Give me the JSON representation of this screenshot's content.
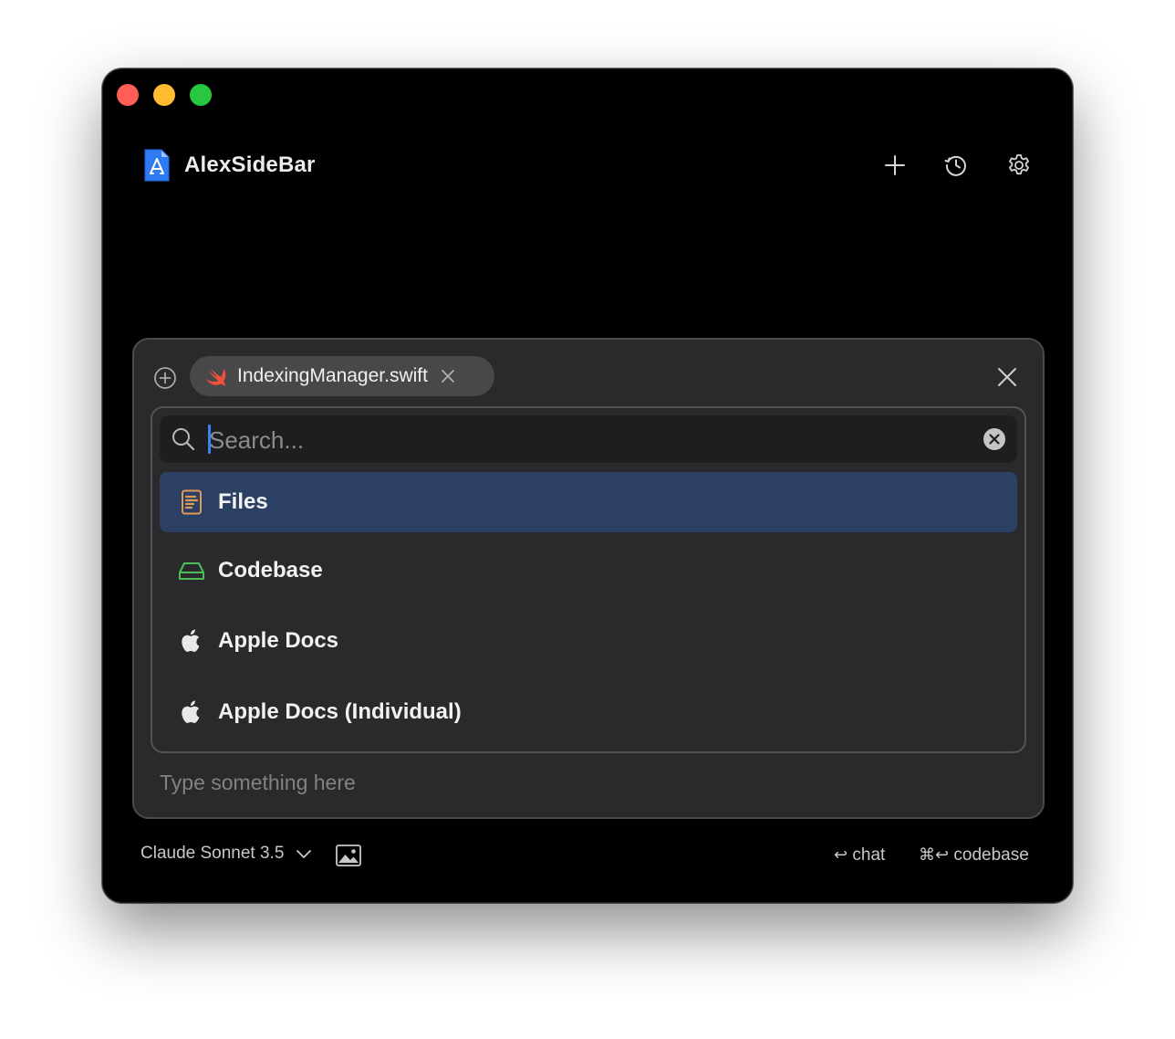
{
  "app": {
    "title": "AlexSideBar"
  },
  "header": {
    "new_icon": "plus-icon",
    "history_icon": "history-icon",
    "settings_icon": "gear-icon"
  },
  "context": {
    "add_icon": "plus-circle-icon",
    "chip_label": "IndexingManager.swift",
    "chip_icon": "swift-icon"
  },
  "search": {
    "placeholder": "Search...",
    "value": ""
  },
  "menu": {
    "items": [
      {
        "label": "Files",
        "icon": "document-icon",
        "color": "#e09a55",
        "selected": true
      },
      {
        "label": "Codebase",
        "icon": "drive-icon",
        "color": "#4cbe57",
        "selected": false
      },
      {
        "label": "Apple Docs",
        "icon": "apple-icon",
        "color": "#e8e8e8",
        "selected": false
      },
      {
        "label": "Apple Docs (Individual)",
        "icon": "apple-icon",
        "color": "#e8e8e8",
        "selected": false
      }
    ]
  },
  "prompt": {
    "placeholder": "Type something here"
  },
  "footer": {
    "model": "Claude Sonnet 3.5",
    "chat_glyph": "↩",
    "chat_label": "chat",
    "codebase_glyph": "⌘↩",
    "codebase_label": "codebase"
  },
  "colors": {
    "accent": "#3b82f6",
    "selection": "#2c4064",
    "panel": "#2a2a2c"
  }
}
